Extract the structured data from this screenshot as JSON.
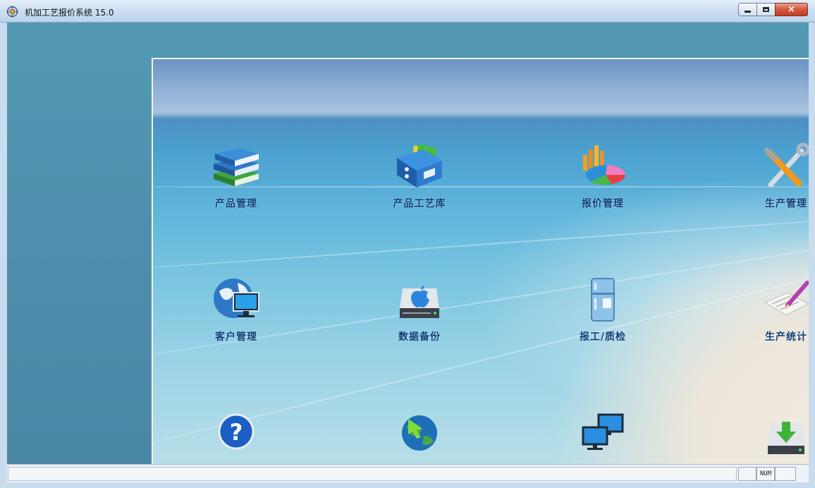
{
  "window": {
    "title": "机加工艺报价系统 15.0",
    "controls": {
      "minimize": "minimize",
      "maximize": "maximize",
      "close": "×"
    }
  },
  "tiles": [
    {
      "label": "产品管理",
      "icon": "books-icon"
    },
    {
      "label": "产品工艺库",
      "icon": "binder-icon"
    },
    {
      "label": "报价管理",
      "icon": "pie-chart-icon"
    },
    {
      "label": "生产管理",
      "icon": "tools-icon"
    },
    {
      "label": "客户管理",
      "icon": "globe-monitor-icon"
    },
    {
      "label": "数据备份",
      "icon": "apple-drive-icon"
    },
    {
      "label": "报工/质检",
      "icon": "fridge-icon"
    },
    {
      "label": "生产统计",
      "icon": "notepad-pencil-icon"
    },
    {
      "label": "",
      "icon": "help-icon"
    },
    {
      "label": "",
      "icon": "globe-arrow-icon"
    },
    {
      "label": "",
      "icon": "network-monitors-icon"
    },
    {
      "label": "",
      "icon": "download-drive-icon"
    }
  ],
  "statusbar": {
    "message": "",
    "num_indicator": "NUM",
    "pane3": ""
  },
  "colors": {
    "client_bg": "#4e8cab",
    "label_text": "#0f3e76",
    "titlebar": "#cfe0f2"
  }
}
